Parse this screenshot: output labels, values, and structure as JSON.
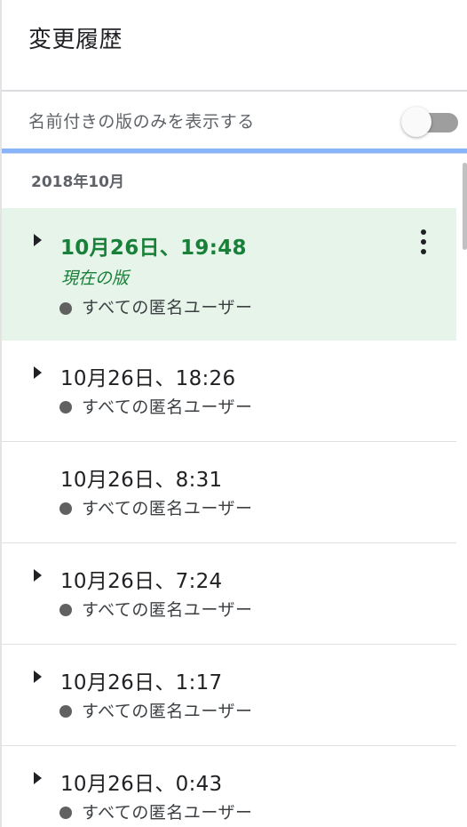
{
  "header": {
    "title": "変更履歴"
  },
  "filter": {
    "label": "名前付きの版のみを表示する",
    "toggle_on": false
  },
  "month": {
    "label": "2018年10月"
  },
  "versions": [
    {
      "time": "10月26日、19:48",
      "current_label": "現在の版",
      "author": "すべての匿名ユーザー",
      "expandable": true,
      "current": true
    },
    {
      "time": "10月26日、18:26",
      "author": "すべての匿名ユーザー",
      "expandable": true
    },
    {
      "time": "10月26日、8:31",
      "author": "すべての匿名ユーザー",
      "expandable": false
    },
    {
      "time": "10月26日、7:24",
      "author": "すべての匿名ユーザー",
      "expandable": true
    },
    {
      "time": "10月26日、1:17",
      "author": "すべての匿名ユーザー",
      "expandable": true
    },
    {
      "time": "10月26日、0:43",
      "author": "すべての匿名ユーザー",
      "expandable": true
    }
  ],
  "icons": {
    "expand": "triangle-right-icon",
    "more": "more-vert-icon",
    "author": "dot-icon"
  },
  "colors": {
    "current_bg": "#e6f4ea",
    "current_text": "#188038",
    "accent_bar": "#8ab4f8"
  }
}
